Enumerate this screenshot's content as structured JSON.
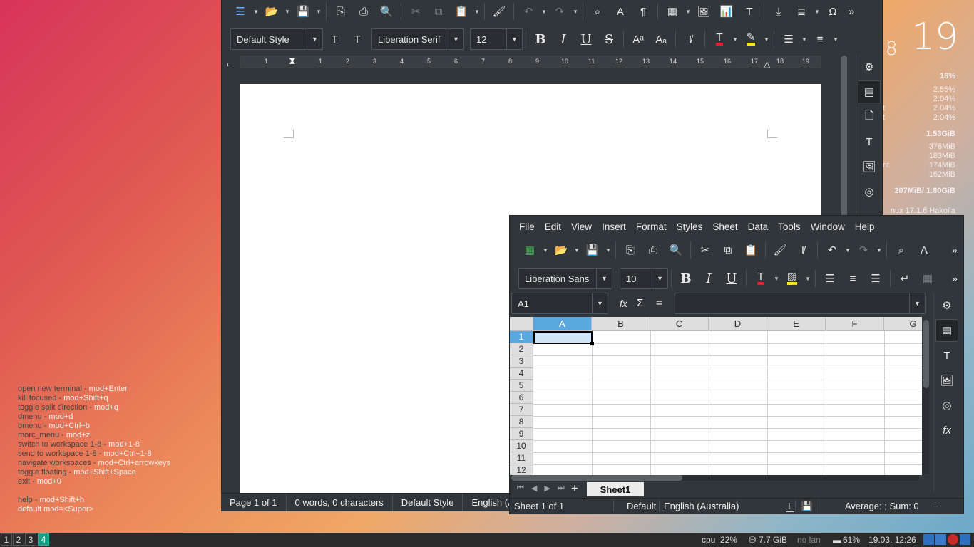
{
  "conky": {
    "day_prev": "8",
    "day": "19",
    "cpu_total": "18%",
    "cpu_cores": [
      "2.55%",
      "2.04%",
      "2.04%",
      "2.04%"
    ],
    "mem_total": "1.53GiB",
    "mem_procs": [
      "376MiB",
      "183MiB",
      "174MiB",
      "162MiB"
    ],
    "swap": "207MiB/ 1.80GiB",
    "os": "nux 17.1.6 Hakoila",
    "partial_labels": [
      "t",
      "t",
      "nt"
    ]
  },
  "hints": [
    {
      "label": "open new terminal",
      "key": "mod+Enter"
    },
    {
      "label": "kill focused",
      "key": "mod+Shift+q"
    },
    {
      "label": "toggle split direction",
      "key": "mod+q"
    },
    {
      "label": "dmenu",
      "key": "mod+d"
    },
    {
      "label": "bmenu",
      "key": "mod+Ctrl+b"
    },
    {
      "label": "morc_menu",
      "key": "mod+z"
    },
    {
      "label": "switch to workspace 1-8",
      "key": "mod+1-8"
    },
    {
      "label": "send to workspace 1-8",
      "key": "mod+Ctrl+1-8"
    },
    {
      "label": "navigate workspaces",
      "key": "mod+Ctrl+arrowkeys"
    },
    {
      "label": "toggle floating",
      "key": "mod+Shift+Space"
    },
    {
      "label": "exit",
      "key": "mod+0"
    }
  ],
  "hint_help": {
    "label": "help",
    "key": "mod+Shift+h"
  },
  "hint_default": "default mod=<Super>",
  "writer": {
    "paragraph_style": "Default Style",
    "font_name": "Liberation Serif",
    "font_size": "12",
    "ruler_numbers": [
      "1",
      "1",
      "2",
      "3",
      "4",
      "5",
      "6",
      "7",
      "8",
      "9",
      "10",
      "11",
      "12",
      "13",
      "14",
      "15",
      "16",
      "17",
      "18",
      "19"
    ],
    "status": {
      "page": "Page 1 of 1",
      "words": "0 words, 0 characters",
      "style": "Default Style",
      "language": "English (A"
    }
  },
  "calc": {
    "menu": [
      "File",
      "Edit",
      "View",
      "Insert",
      "Format",
      "Styles",
      "Sheet",
      "Data",
      "Tools",
      "Window",
      "Help"
    ],
    "font_name": "Liberation Sans",
    "font_size": "10",
    "name_box": "A1",
    "formula_icons": {
      "function": "fx",
      "sum": "Σ",
      "equals": "="
    },
    "columns": [
      "A",
      "B",
      "C",
      "D",
      "E",
      "F",
      "G"
    ],
    "rows": [
      "1",
      "2",
      "3",
      "4",
      "5",
      "6",
      "7",
      "8",
      "9",
      "10",
      "11",
      "12"
    ],
    "sheet_tab": "Sheet1",
    "status": {
      "sheet": "Sheet 1 of 1",
      "style": "Default",
      "language": "English (Australia)",
      "summary": "Average: ; Sum: 0"
    }
  },
  "taskbar": {
    "workspaces": [
      "1",
      "2",
      "3",
      "4"
    ],
    "active_workspace": "4",
    "cpu": "cpu  22%",
    "mem": "7.7 GiB",
    "net": "no lan",
    "battery": "61%",
    "datetime": "19.03. 12:26"
  }
}
